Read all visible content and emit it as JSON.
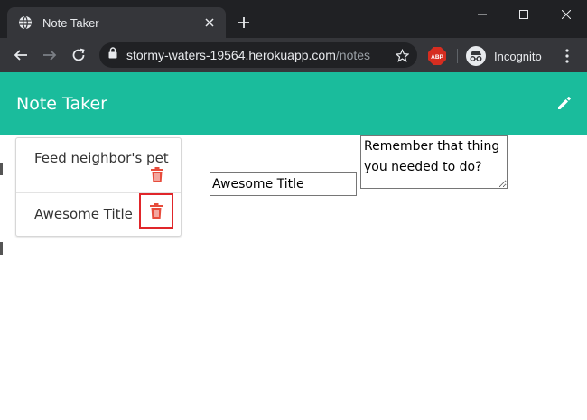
{
  "browser": {
    "tab_title": "Note Taker",
    "url_host": "stormy-waters-19564.herokuapp.com",
    "url_path": "/notes",
    "incognito_label": "Incognito",
    "abp_label": "ABP",
    "icons": {
      "tab_favicon": "globe-icon",
      "tab_close": "close-icon",
      "new_tab": "plus-icon",
      "back": "arrow-left-icon",
      "forward": "arrow-right-icon",
      "reload": "reload-icon",
      "lock": "lock-icon",
      "bookmark": "star-icon",
      "extension": "adblock-icon",
      "incognito": "incognito-icon",
      "menu": "kebab-menu-icon"
    }
  },
  "app": {
    "title": "Note Taker",
    "header_color": "#1abc9c",
    "edit_icon": "pencil-icon"
  },
  "notes": [
    {
      "title": "Feed neighbor's pet",
      "delete_icon": "trash-icon"
    },
    {
      "title": "Awesome Title",
      "delete_icon": "trash-icon"
    }
  ],
  "editor": {
    "title_value": "Awesome Title",
    "text_value": "Remember that thing you needed to do?"
  },
  "colors": {
    "accent": "#1abc9c",
    "delete": "#e74c3c",
    "highlight": "#e0262a"
  }
}
